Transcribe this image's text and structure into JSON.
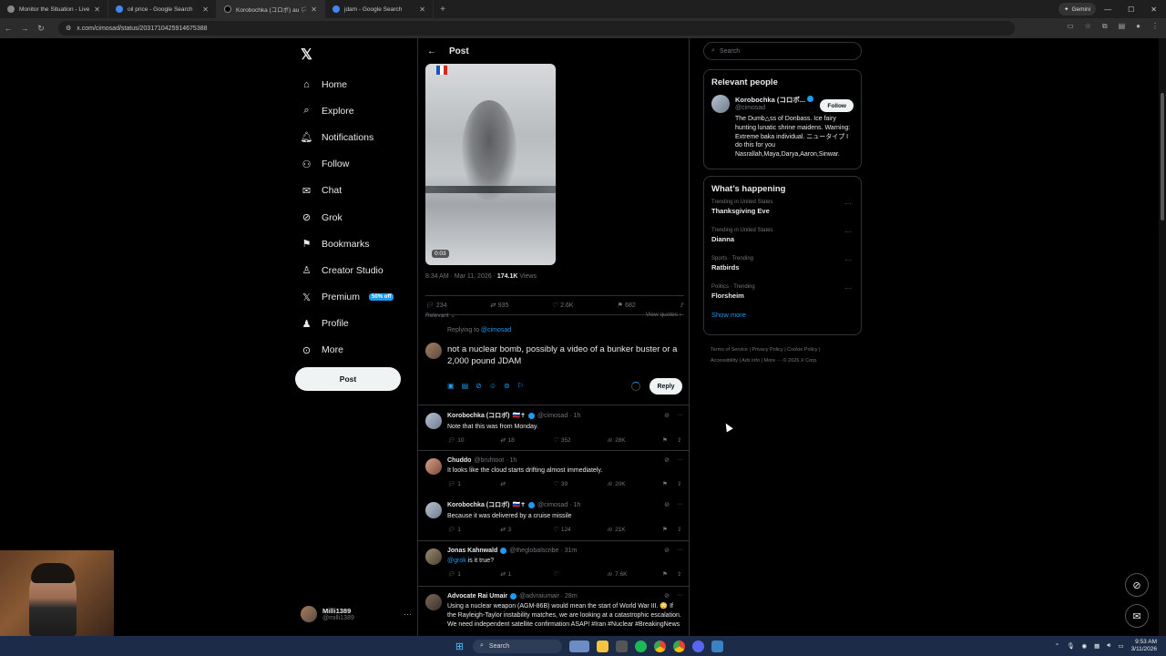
{
  "browser": {
    "tabs": [
      {
        "title": "Monitor the Situation - Live Gl",
        "active": false
      },
      {
        "title": "oil price - Google Search",
        "active": false
      },
      {
        "title": "Korobochka (コロボ) au 🏳 on X",
        "active": true
      },
      {
        "title": "jdam - Google Search",
        "active": false
      }
    ],
    "url": "x.com/cimosad/status/2031710425914675388",
    "gemini_label": "Gemini"
  },
  "nav": {
    "items": [
      {
        "label": "Home",
        "icon": "home-icon"
      },
      {
        "label": "Explore",
        "icon": "search-icon"
      },
      {
        "label": "Notifications",
        "icon": "bell-icon"
      },
      {
        "label": "Follow",
        "icon": "person-plus-icon"
      },
      {
        "label": "Chat",
        "icon": "mail-icon"
      },
      {
        "label": "Grok",
        "icon": "grok-icon"
      },
      {
        "label": "Bookmarks",
        "icon": "bookmark-icon"
      },
      {
        "label": "Creator Studio",
        "icon": "creator-icon"
      },
      {
        "label": "Premium",
        "icon": "x-icon",
        "badge": "50% off"
      },
      {
        "label": "Profile",
        "icon": "person-icon"
      },
      {
        "label": "More",
        "icon": "more-circle-icon"
      }
    ],
    "post_label": "Post"
  },
  "account": {
    "name": "Milli1389",
    "handle": "@milli1389"
  },
  "post": {
    "header_title": "Post",
    "video_time": "0:03",
    "timestamp": "8:34 AM · Mar 11, 2026 ·",
    "views": "174.1K",
    "views_label": "Views",
    "replies": "234",
    "reposts": "935",
    "likes": "2.6K",
    "bookmarks": "682",
    "sort_label": "Relevant",
    "view_quotes": "View quotes",
    "replying_prefix": "Replying to",
    "replying_to": "@cimosad",
    "compose_text": "not a nuclear bomb, possibly a video of a bunker buster or a 2,000 pound JDAM",
    "reply_button": "Reply"
  },
  "replies": [
    {
      "name": "Korobochka (コロボ)",
      "handle": "@cimosad · 1h",
      "text": "Note that this was from Monday.",
      "replies": "10",
      "reposts": "18",
      "likes": "352",
      "views": "28K"
    },
    {
      "name": "Chuddo",
      "handle": "@bruhtoot · 1h",
      "text": "It looks like the cloud starts drifting almost immediately.",
      "replies": "1",
      "reposts": "",
      "likes": "39",
      "views": "20K"
    },
    {
      "name": "Korobochka (コロボ)",
      "handle": "@cimosad · 1h",
      "text": "Because it was delivered by a cruise missile",
      "replies": "1",
      "reposts": "3",
      "likes": "124",
      "views": "21K"
    },
    {
      "name": "Jonas Kahnwald",
      "handle": "@theglobalscribe · 31m",
      "mention": "@grok",
      "text": "is it true?",
      "replies": "1",
      "reposts": "1",
      "likes": "",
      "views": "7.6K"
    },
    {
      "name": "Advocate Rai Umair",
      "handle": "@advraiumair · 28m",
      "text": "Using a nuclear weapon (AGM-86B) would mean the start of World War III. 😳 If the Rayleigh-Taylor instability matches, we are looking at a catastrophic escalation. We need independent satellite confirmation ASAP! #Iran #Nuclear #BreakingNews",
      "replies": "",
      "reposts": "",
      "likes": "",
      "views": ""
    }
  ],
  "right": {
    "search_placeholder": "Search",
    "relevant_title": "Relevant people",
    "person": {
      "name": "Korobochka (コロボ...",
      "handle": "@cimosad",
      "follow_label": "Follow",
      "bio": "The Dumb△ss of Donbass. Ice fairy hunting lunatic shrine maidens. Warning: Extreme baka individual. ニュータイプ I do this for you Nasrallah,Maya,Darya,Aaron,Sinwar."
    },
    "happening_title": "What’s happening",
    "trends": [
      {
        "context": "Trending in United States",
        "topic": "Thanksgiving Eve"
      },
      {
        "context": "Trending in United States",
        "topic": "Dianna"
      },
      {
        "context": "Sports · Trending",
        "topic": "Ratbirds"
      },
      {
        "context": "Politics · Trending",
        "topic": "Florsheim"
      }
    ],
    "show_more": "Show more",
    "footer_line1": "Terms of Service | Privacy Policy | Cookie Policy |",
    "footer_line2": "Accessibility | Ads info | More ··· © 2026 X Corp."
  },
  "taskbar": {
    "search_label": "Search",
    "time": "9:53 AM",
    "date": "3/11/2026"
  },
  "colors": {
    "accent": "#1d9bf0",
    "background": "#000000",
    "border": "#2f3336",
    "muted": "#71767b"
  }
}
